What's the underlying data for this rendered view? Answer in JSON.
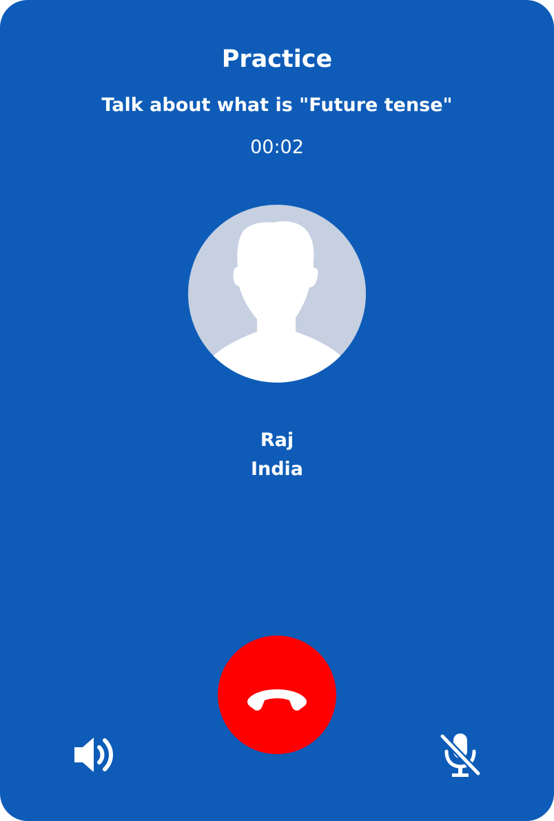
{
  "header": {
    "title": "Practice",
    "topic": "Talk about what is \"Future tense\"",
    "timer": "00:02"
  },
  "contact": {
    "avatar_icon": "person-silhouette-icon",
    "name": "Raj",
    "country": "India"
  },
  "controls": {
    "speaker_icon": "speaker-icon",
    "hangup_icon": "phone-hangup-icon",
    "mic_icon": "mic-muted-icon"
  },
  "colors": {
    "background": "#0e5cb8",
    "hangup": "#fe0000",
    "avatar_bg": "#c6d0e1",
    "text": "#ffffff"
  }
}
